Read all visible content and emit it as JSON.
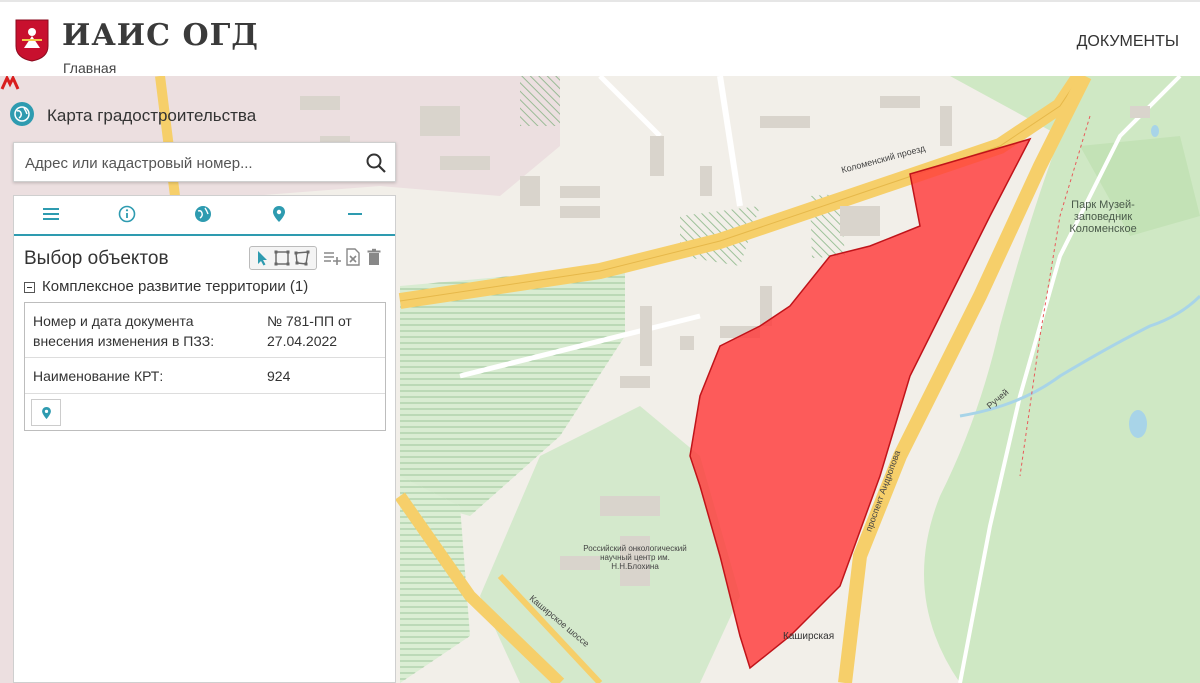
{
  "header": {
    "title": "ИАИС ОГД",
    "subtitle": "Главная",
    "docs_link": "ДОКУМЕНТЫ",
    "logo_icon": "moscow-coat-of-arms-icon"
  },
  "map": {
    "title": "Карта градостроительства",
    "title_icon": "globe-icon",
    "search_placeholder": "Адрес или кадастровый номер...",
    "labels": {
      "park": "Парк Музей-заповедник Коломенское",
      "street_kolomensky": "Коломенский проезд",
      "street_kashirskoe": "Каширское шоссе",
      "street_andropova": "проспект Андропова",
      "metro": "Каширская",
      "stream": "Ручей",
      "cancer_center": "Российский онкологический научный центр им. Н.Н.Блохина"
    },
    "colors": {
      "highlight_area": "#ff3b3b",
      "accent": "#2e9bb0",
      "road": "#f6cf6a",
      "park": "#cfe8c4"
    }
  },
  "panel": {
    "tabs": [
      {
        "name": "menu",
        "icon": "menu-icon"
      },
      {
        "name": "info",
        "icon": "info-icon"
      },
      {
        "name": "layers",
        "icon": "globe-icon"
      },
      {
        "name": "selection",
        "icon": "map-pin-icon"
      },
      {
        "name": "collapse",
        "icon": "minus-icon"
      }
    ],
    "selection_title": "Выбор объектов",
    "toolbar": [
      "cursor-select-icon",
      "box-select-icon",
      "polygon-select-icon",
      "add-list-icon",
      "export-excel-icon",
      "trash-icon"
    ],
    "section_title": "Комплексное развитие территории (1)",
    "rows": [
      {
        "key": "Номер и дата документа внесения изменения в ПЗЗ:",
        "value": "№ 781-ПП от 27.04.2022"
      },
      {
        "key": "Наименование КРТ:",
        "value": "924"
      }
    ],
    "locate_icon": "map-pin-icon"
  }
}
